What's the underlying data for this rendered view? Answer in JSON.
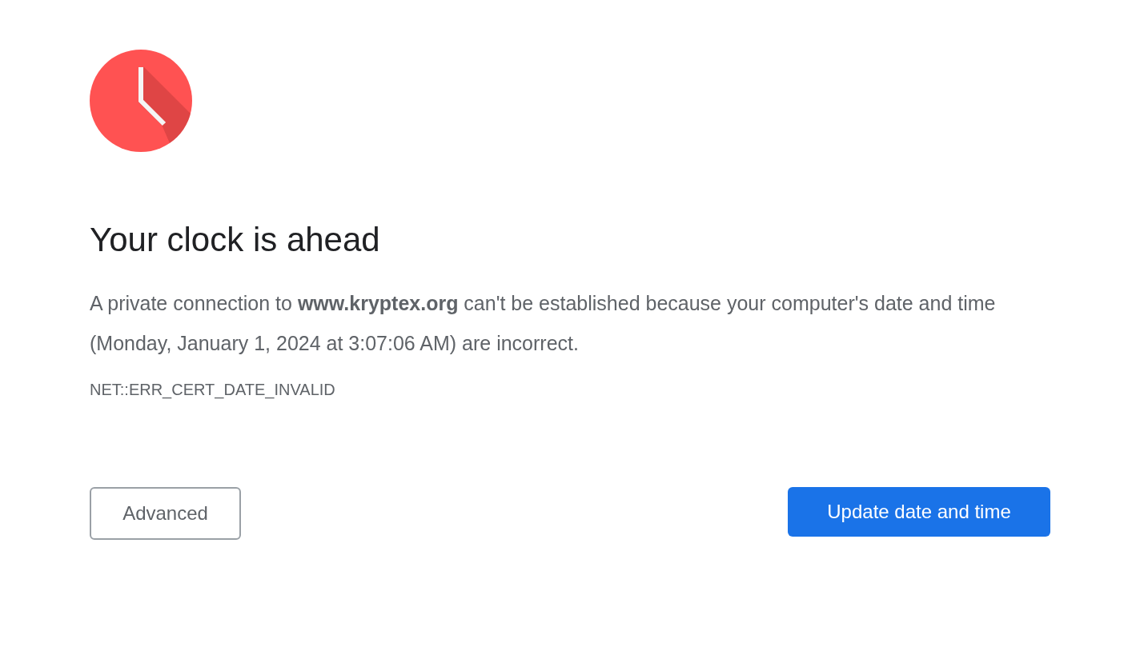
{
  "heading": "Your clock is ahead",
  "message": "A private connection to **www.kryptex.org** can't be established because your computer's date and time (Monday, January 1, 2024 at 3:07:06 AM) are incorrect.",
  "error_code": "NET::ERR_CERT_DATE_INVALID",
  "buttons": [
    {
      "label": "Advanced",
      "kind": "secondary"
    },
    {
      "label": "Update date and time",
      "kind": "primary"
    }
  ]
}
